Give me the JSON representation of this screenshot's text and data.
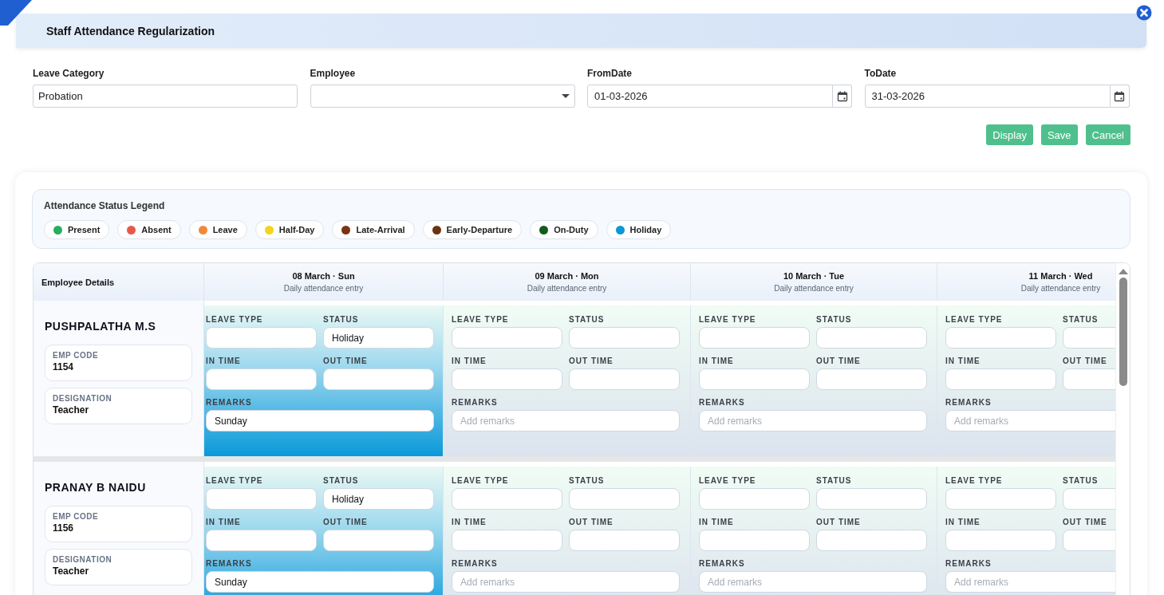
{
  "dialog": {
    "title": "Staff Attendance Regularization"
  },
  "filters": [
    {
      "kind": "text",
      "label": "Leave Category",
      "value": "Probation"
    },
    {
      "kind": "select",
      "label": "Employee"
    },
    {
      "kind": "date",
      "label": "FromDate",
      "value": "01-03-2026"
    },
    {
      "kind": "date",
      "label": "ToDate",
      "value": "31-03-2026"
    }
  ],
  "buttons": [
    "Display",
    "Save",
    "Cancel"
  ],
  "legend": {
    "title": "Attendance Status Legend",
    "items": [
      {
        "label": "Present",
        "color": "#27ae60"
      },
      {
        "label": "Absent",
        "color": "#e8594a"
      },
      {
        "label": "Leave",
        "color": "#f08a3a"
      },
      {
        "label": "Half-Day",
        "color": "#f4d41f"
      },
      {
        "label": "Late-Arrival",
        "color": "#7b3412"
      },
      {
        "label": "Early-Departure",
        "color": "#6a3312"
      },
      {
        "label": "On-Duty",
        "color": "#155a1f"
      },
      {
        "label": "Holiday",
        "color": "#0b97d9"
      }
    ]
  },
  "grid": {
    "corner_header": "Employee Details",
    "days": [
      {
        "date": "08 March · Sun",
        "subtitle": "Daily attendance entry"
      },
      {
        "date": "09 March · Mon",
        "subtitle": "Daily attendance entry"
      },
      {
        "date": "10 March · Tue",
        "subtitle": "Daily attendance entry"
      },
      {
        "date": "11 March · Wed",
        "subtitle": "Daily attendance entry"
      }
    ],
    "employees": [
      {
        "name": "PUSHPALATHA M.S",
        "details": [
          {
            "label": "EMP CODE",
            "value": "1154"
          },
          {
            "label": "DESIGNATION",
            "value": "Teacher"
          }
        ],
        "cells": [
          {
            "holiday": true,
            "fields": [
              {
                "label": "LEAVE TYPE"
              },
              {
                "label": "STATUS",
                "value": "Holiday"
              },
              {
                "label": "IN TIME"
              },
              {
                "label": "OUT TIME"
              },
              {
                "label": "REMARKS",
                "value": "Sunday"
              }
            ]
          },
          {
            "holiday": false,
            "fields": [
              {
                "label": "LEAVE TYPE"
              },
              {
                "label": "STATUS"
              },
              {
                "label": "IN TIME"
              },
              {
                "label": "OUT TIME"
              },
              {
                "label": "REMARKS",
                "placeholder": "Add remarks"
              }
            ]
          },
          {
            "holiday": false,
            "fields": [
              {
                "label": "LEAVE TYPE"
              },
              {
                "label": "STATUS"
              },
              {
                "label": "IN TIME"
              },
              {
                "label": "OUT TIME"
              },
              {
                "label": "REMARKS",
                "placeholder": "Add remarks"
              }
            ]
          },
          {
            "holiday": false,
            "fields": [
              {
                "label": "LEAVE TYPE"
              },
              {
                "label": "STATUS"
              },
              {
                "label": "IN TIME"
              },
              {
                "label": "OUT TIME"
              },
              {
                "label": "REMARKS",
                "placeholder": "Add remarks"
              }
            ]
          }
        ]
      },
      {
        "name": "PRANAY B NAIDU",
        "details": [
          {
            "label": "EMP CODE",
            "value": "1156"
          },
          {
            "label": "DESIGNATION",
            "value": "Teacher"
          }
        ],
        "cells": [
          {
            "holiday": true,
            "fields": [
              {
                "label": "LEAVE TYPE"
              },
              {
                "label": "STATUS",
                "value": "Holiday"
              },
              {
                "label": "IN TIME"
              },
              {
                "label": "OUT TIME"
              },
              {
                "label": "REMARKS",
                "value": "Sunday"
              }
            ]
          },
          {
            "holiday": false,
            "fields": [
              {
                "label": "LEAVE TYPE"
              },
              {
                "label": "STATUS"
              },
              {
                "label": "IN TIME"
              },
              {
                "label": "OUT TIME"
              },
              {
                "label": "REMARKS",
                "placeholder": "Add remarks"
              }
            ]
          },
          {
            "holiday": false,
            "fields": [
              {
                "label": "LEAVE TYPE"
              },
              {
                "label": "STATUS"
              },
              {
                "label": "IN TIME"
              },
              {
                "label": "OUT TIME"
              },
              {
                "label": "REMARKS",
                "placeholder": "Add remarks"
              }
            ]
          },
          {
            "holiday": false,
            "fields": [
              {
                "label": "LEAVE TYPE"
              },
              {
                "label": "STATUS"
              },
              {
                "label": "IN TIME"
              },
              {
                "label": "OUT TIME"
              },
              {
                "label": "REMARKS",
                "placeholder": "Add remarks"
              }
            ]
          }
        ]
      }
    ]
  }
}
